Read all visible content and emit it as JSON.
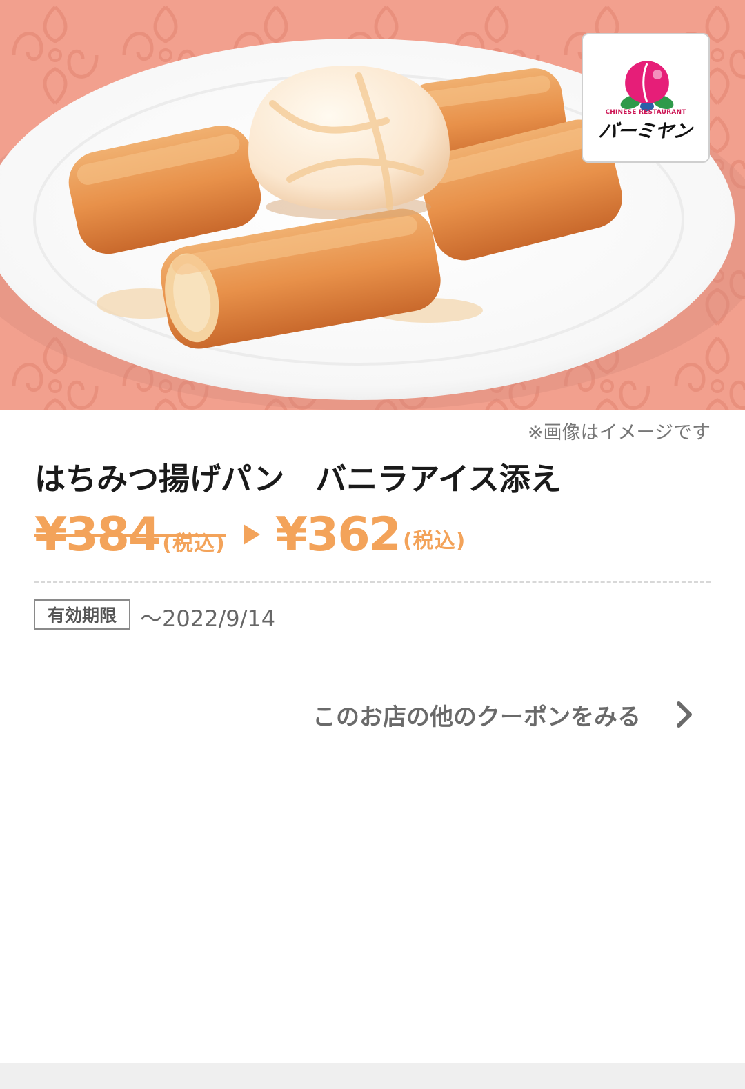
{
  "hero": {
    "image_icon": "honey-fried-bread-with-vanilla-ice-cream-photo",
    "background_color": "#f2a08e"
  },
  "logo": {
    "icon": "peach-icon",
    "subtitle": "CHINESE RESTAURANT",
    "name": "バーミヤン"
  },
  "note": "※画像はイメージです",
  "product": {
    "title": "はちみつ揚げパン　バニラアイス添え"
  },
  "price": {
    "original": "¥384",
    "original_tax": "(税込)",
    "arrow_icon": "play-arrow-icon",
    "discounted": "¥362",
    "discounted_tax": "(税込)",
    "color": "#f3a35a"
  },
  "expiry": {
    "label": "有効期限",
    "value": "〜2022/9/14"
  },
  "more_link": {
    "label": "このお店の他のクーポンをみる",
    "icon": "chevron-right-icon"
  }
}
